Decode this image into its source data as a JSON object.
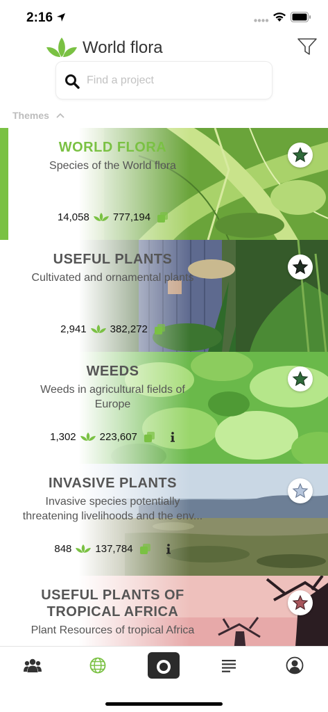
{
  "status_bar": {
    "time": "2:16"
  },
  "header": {
    "title": "World flora"
  },
  "search": {
    "placeholder": "Find a project",
    "value": ""
  },
  "themes": {
    "label": "Themes",
    "expanded": true
  },
  "accent_color": "#7ac143",
  "projects": [
    {
      "title_lines": [
        "WORLD FLORA"
      ],
      "subtitle_lines": [
        "Species of the World flora"
      ],
      "species_count": "14,058",
      "image_count": "777,194",
      "has_info": false,
      "selected": true,
      "favorite_style": "filled-dark-green",
      "image": "fern-leaves"
    },
    {
      "title_lines": [
        "USEFUL PLANTS"
      ],
      "subtitle_lines": [
        "Cultivated and ornamental plants"
      ],
      "species_count": "2,941",
      "image_count": "382,272",
      "has_info": false,
      "selected": false,
      "favorite_style": "filled-dark",
      "image": "garden-plants"
    },
    {
      "title_lines": [
        "WEEDS"
      ],
      "subtitle_lines": [
        "Weeds in agricultural fields of",
        "Europe"
      ],
      "species_count": "1,302",
      "image_count": "223,607",
      "has_info": true,
      "selected": false,
      "favorite_style": "filled-dark-green",
      "image": "green-weeds"
    },
    {
      "title_lines": [
        "INVASIVE PLANTS"
      ],
      "subtitle_lines": [
        "Invasive species potentially",
        "threatening livelihoods and the env..."
      ],
      "species_count": "848",
      "image_count": "137,784",
      "has_info": true,
      "selected": false,
      "favorite_style": "outline-blue",
      "image": "savanna-landscape"
    },
    {
      "title_lines": [
        "USEFUL PLANTS OF",
        "TROPICAL AFRICA"
      ],
      "subtitle_lines": [
        "Plant Resources of tropical Africa"
      ],
      "species_count": "",
      "image_count": "",
      "has_info": false,
      "selected": false,
      "favorite_style": "filled-red",
      "image": "baobab-sunset"
    }
  ],
  "tab_bar": {
    "tabs": [
      {
        "icon": "community-icon"
      },
      {
        "icon": "globe-icon",
        "active": true
      },
      {
        "icon": "camera-icon"
      },
      {
        "icon": "list-icon"
      },
      {
        "icon": "profile-icon"
      }
    ]
  }
}
